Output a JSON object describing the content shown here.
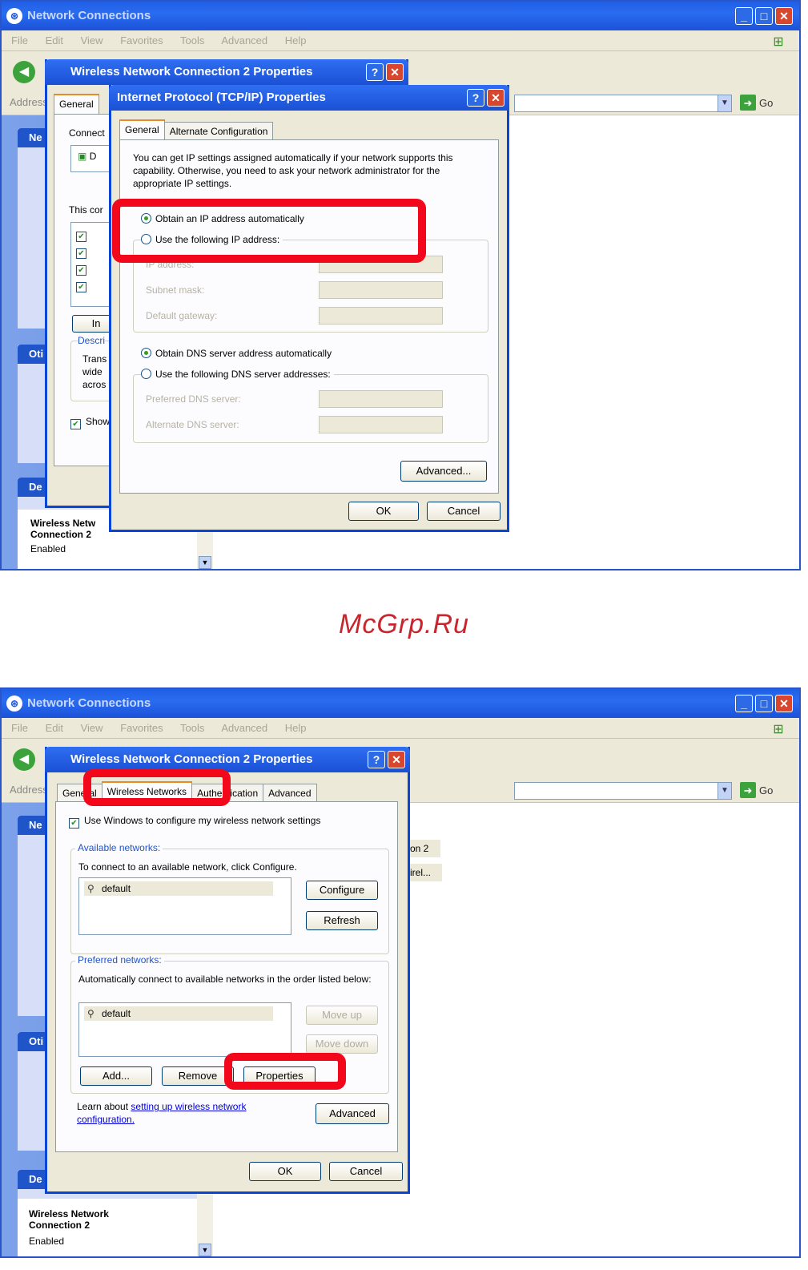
{
  "watermark": "McGrp.Ru",
  "window": {
    "title": "Network Connections",
    "menu": [
      "File",
      "Edit",
      "View",
      "Favorites",
      "Tools",
      "Advanced",
      "Help"
    ],
    "address_label": "Address",
    "go_label": "Go"
  },
  "shot1": {
    "taskpane_status": "Enabled",
    "taskpane_conn": "Wireless Netw Connection 2",
    "partial": {
      "ne": "Ne",
      "oti": "Oti",
      "de": "De",
      "general_tab": "General",
      "connect": "Connect",
      "d": "D",
      "this_con": "This cor",
      "descr": "Descri",
      "trans": "Trans",
      "wide": "wide",
      "acros": "acros",
      "show": "Show",
      "in": "In"
    },
    "back_dialog_title": "Wireless Network Connection 2 Properties",
    "tcpip": {
      "title": "Internet Protocol (TCP/IP) Properties",
      "tabs": [
        "General",
        "Alternate Configuration"
      ],
      "intro": "You can get IP settings assigned automatically if your network supports this capability. Otherwise, you need to ask your network administrator for the appropriate IP settings.",
      "opt_auto_ip": "Obtain an IP address automatically",
      "opt_static_ip": "Use the following IP address:",
      "ip_label": "IP address:",
      "subnet_label": "Subnet mask:",
      "gateway_label": "Default gateway:",
      "opt_auto_dns": "Obtain DNS server address automatically",
      "opt_static_dns": "Use the following DNS server addresses:",
      "pref_dns_label": "Preferred DNS server:",
      "alt_dns_label": "Alternate DNS server:",
      "advanced_btn": "Advanced...",
      "ok_btn": "OK",
      "cancel_btn": "Cancel"
    }
  },
  "shot2": {
    "taskpane_conn": "Wireless Network Connection 2",
    "taskpane_status": "Enabled",
    "right_items": [
      "on 2",
      "irel..."
    ],
    "partial": {
      "ne": "Ne",
      "oti": "Oti",
      "de": "De"
    },
    "wnc": {
      "title": "Wireless Network Connection 2 Properties",
      "tabs": [
        "General",
        "Wireless Networks",
        "Authentication",
        "Advanced"
      ],
      "use_windows": "Use Windows to configure my wireless network settings",
      "available_title": "Available networks:",
      "available_desc": "To connect to an available network, click Configure.",
      "available_item": "default",
      "configure_btn": "Configure",
      "refresh_btn": "Refresh",
      "preferred_title": "Preferred networks:",
      "preferred_desc": "Automatically connect to available networks in the order listed below:",
      "preferred_item": "default",
      "move_up_btn": "Move up",
      "move_down_btn": "Move down",
      "add_btn": "Add...",
      "remove_btn": "Remove",
      "properties_btn": "Properties",
      "learn_text": "Learn about",
      "learn_link": "setting up wireless network configuration.",
      "advanced_btn": "Advanced",
      "ok_btn": "OK",
      "cancel_btn": "Cancel"
    }
  },
  "colors": {
    "highlight": "#f2081a",
    "xp_blue": "#0a46d6",
    "watermark": "#c8252d"
  }
}
